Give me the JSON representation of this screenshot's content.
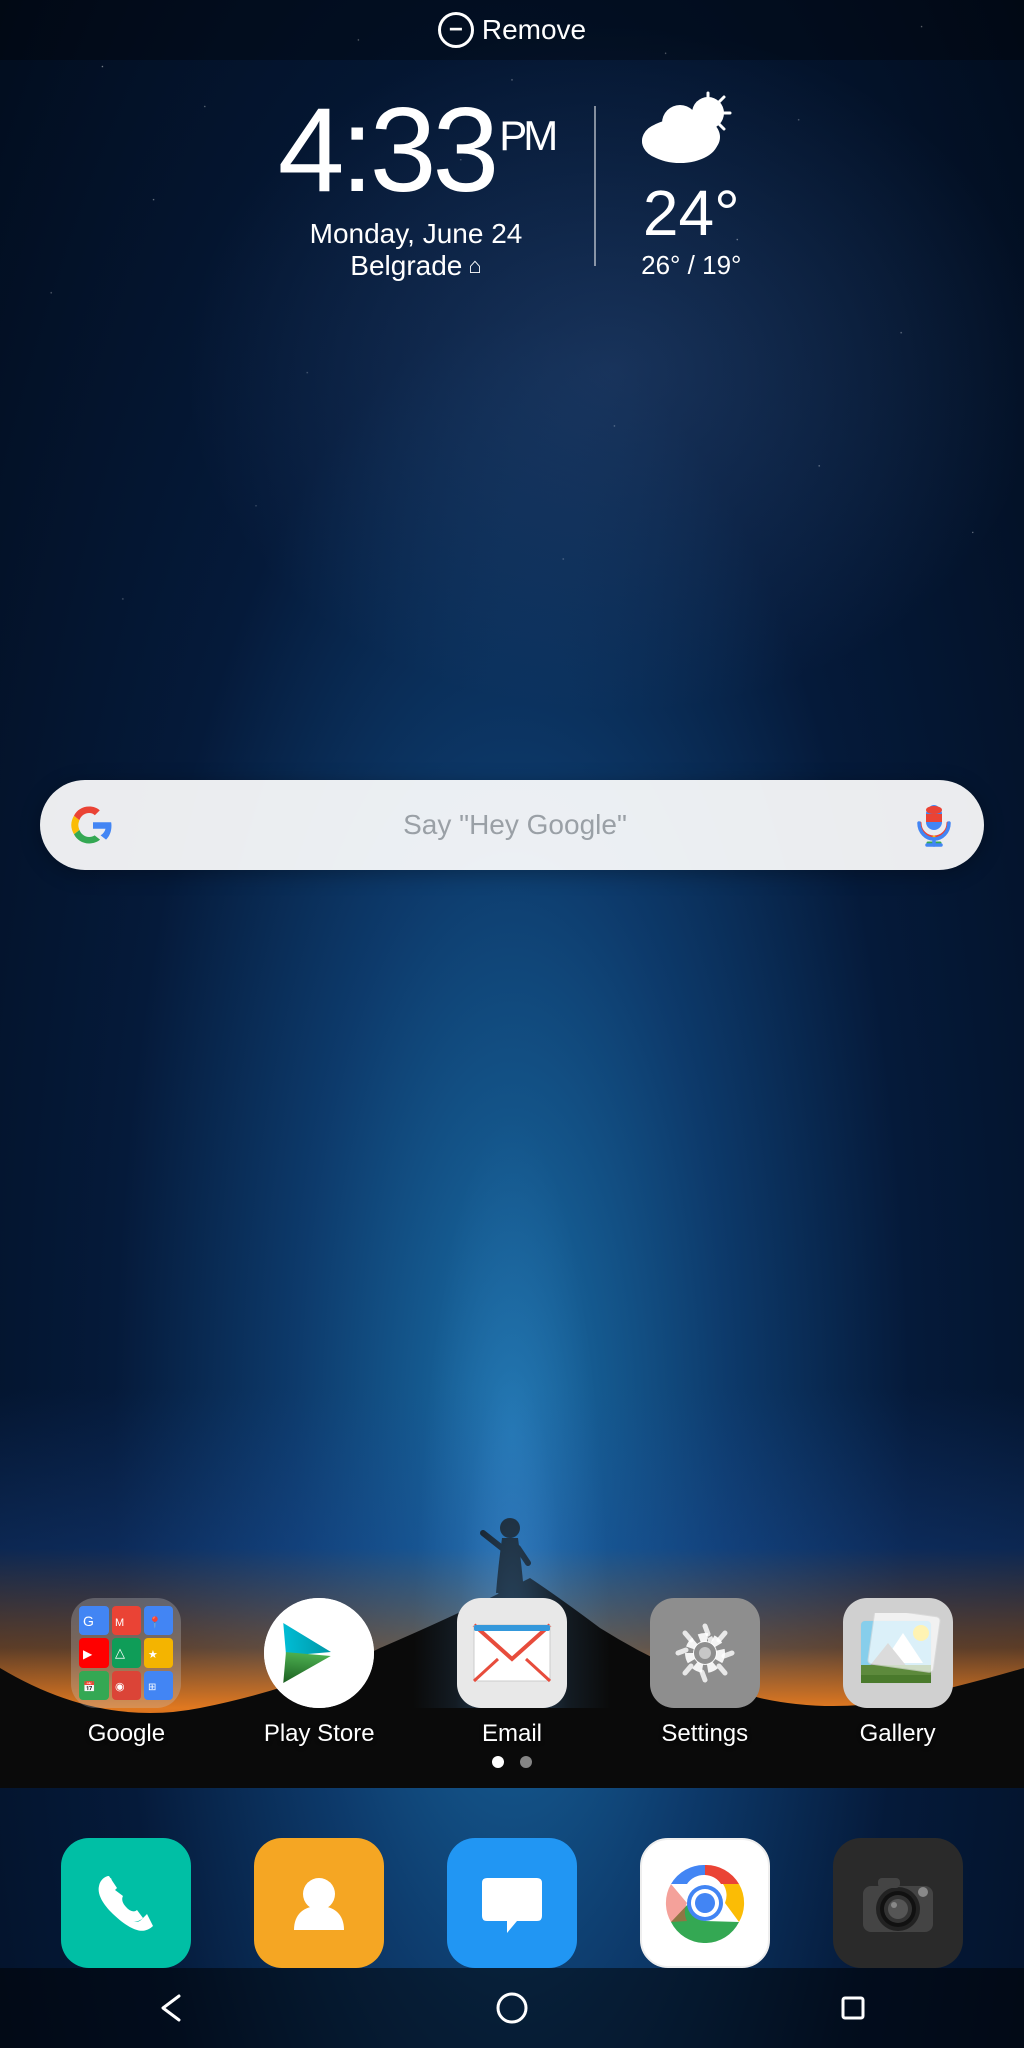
{
  "status_bar": {
    "remove_label": "Remove"
  },
  "clock": {
    "time": "4:33",
    "ampm": "PM",
    "date": "Monday, June 24",
    "location": "Belgrade"
  },
  "weather": {
    "temperature": "24°",
    "high": "26°",
    "low": "19°",
    "condition": "Partly Cloudy"
  },
  "search": {
    "placeholder": "Say \"Hey Google\""
  },
  "apps": [
    {
      "label": "Google",
      "type": "folder"
    },
    {
      "label": "Play Store",
      "type": "playstore"
    },
    {
      "label": "Email",
      "type": "email"
    },
    {
      "label": "Settings",
      "type": "settings"
    },
    {
      "label": "Gallery",
      "type": "gallery"
    }
  ],
  "dock": [
    {
      "label": "Phone",
      "type": "phone"
    },
    {
      "label": "Contacts",
      "type": "contacts"
    },
    {
      "label": "Messages",
      "type": "messages"
    },
    {
      "label": "Chrome",
      "type": "chrome"
    },
    {
      "label": "Camera",
      "type": "camera"
    }
  ],
  "nav": {
    "back": "◁",
    "home": "○",
    "recents": "□"
  }
}
